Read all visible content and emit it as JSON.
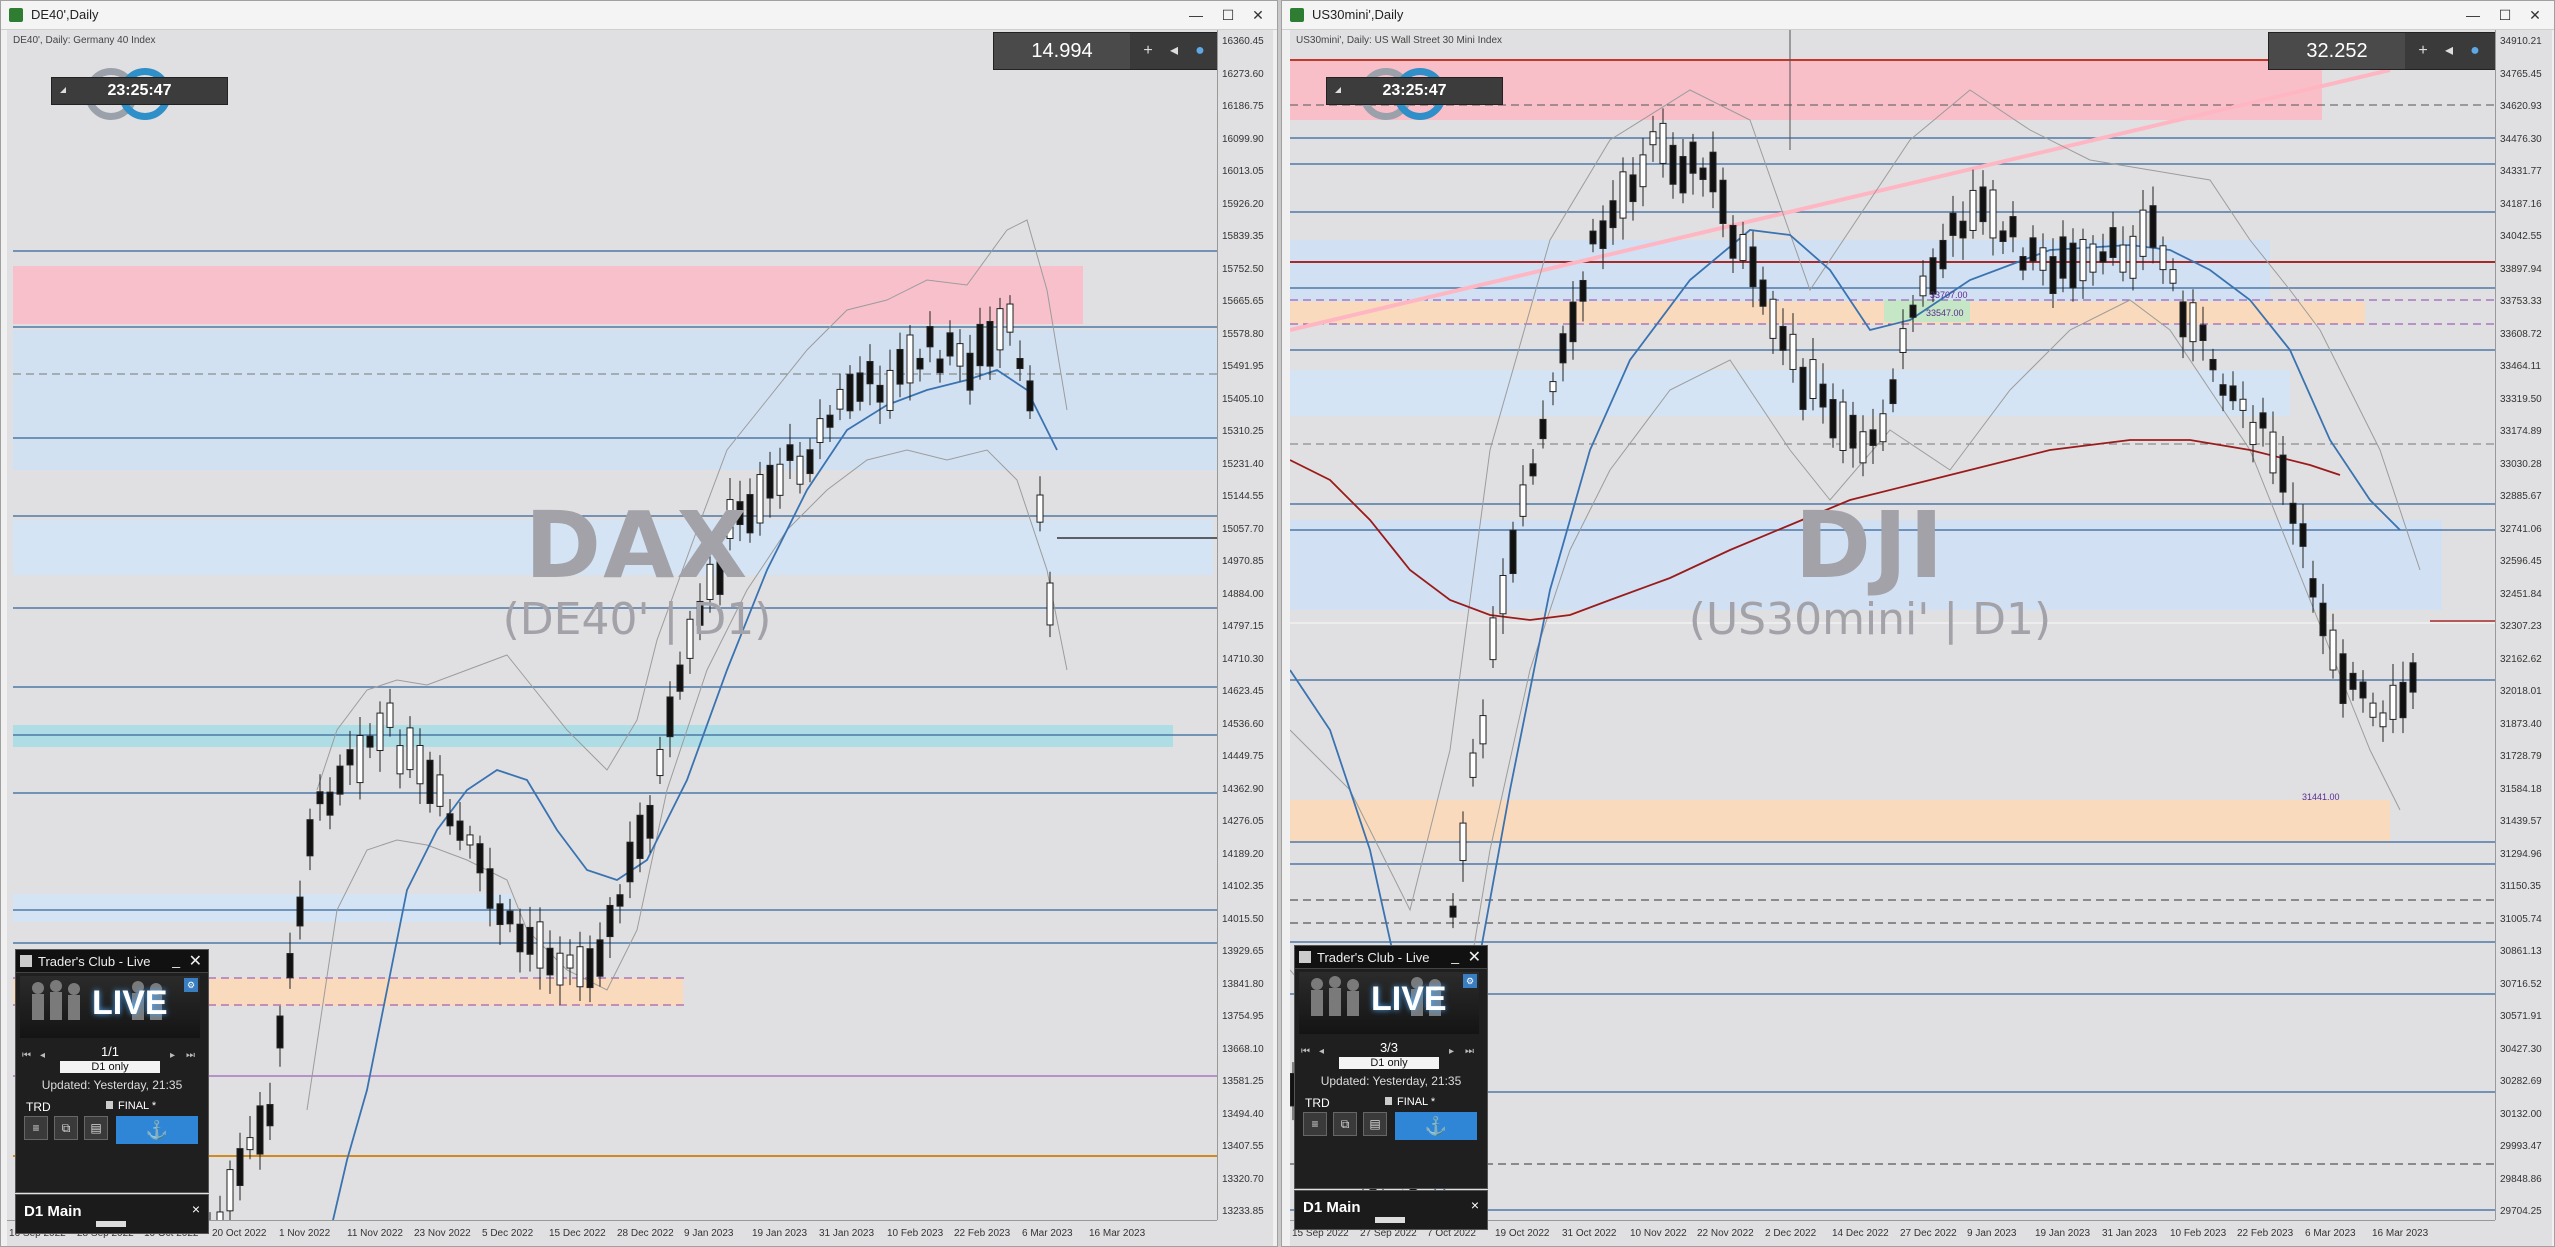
{
  "windows": [
    {
      "title": "DE40',Daily",
      "symbol_info": "DE40', Daily:  Germany 40 Index",
      "watermark_big": "DAX",
      "watermark_small": "(DE40' | D1)",
      "price_box": "14.994",
      "clock": "23:25:47",
      "price_labels": [
        "16360.45",
        "16273.60",
        "16186.75",
        "16099.90",
        "16013.05",
        "15926.20",
        "15839.35",
        "15752.50",
        "15665.65",
        "15578.80",
        "15491.95",
        "15405.10",
        "15310.25",
        "15231.40",
        "15144.55",
        "15057.70",
        "14970.85",
        "14884.00",
        "14797.15",
        "14710.30",
        "14623.45",
        "14536.60",
        "14449.75",
        "14362.90",
        "14276.05",
        "14189.20",
        "14102.35",
        "14015.50",
        "13929.65",
        "13841.80",
        "13754.95",
        "13668.10",
        "13581.25",
        "13494.40",
        "13407.55",
        "13320.70",
        "13233.85"
      ],
      "date_labels": [
        "16 Sep 2022",
        "28 Sep 2022",
        "10 Oct 2022",
        "20 Oct 2022",
        "1 Nov 2022",
        "11 Nov 2022",
        "23 Nov 2022",
        "5 Dec 2022",
        "15 Dec 2022",
        "28 Dec 2022",
        "9 Jan 2023",
        "19 Jan 2023",
        "31 Jan 2023",
        "10 Feb 2023",
        "22 Feb 2023",
        "6 Mar 2023",
        "16 Mar 2023"
      ],
      "panel": {
        "title": "Trader's Club - Live",
        "live": "LIVE",
        "page": "1/1",
        "filter": "D1 only",
        "updated": "Updated: Yesterday, 21:35",
        "trd": "TRD",
        "final": "FINAL *"
      },
      "d1_main": "D1 Main"
    },
    {
      "title": "US30mini',Daily",
      "symbol_info": "US30mini', Daily:  US Wall Street 30 Mini Index",
      "watermark_big": "DJI",
      "watermark_small": "(US30mini' | D1)",
      "price_box": "32.252",
      "clock": "23:25:47",
      "price_labels": [
        "34910.21",
        "34765.45",
        "34620.93",
        "34476.30",
        "34331.77",
        "34187.16",
        "34042.55",
        "33897.94",
        "33753.33",
        "33608.72",
        "33464.11",
        "33319.50",
        "33174.89",
        "33030.28",
        "32885.67",
        "32741.06",
        "32596.45",
        "32451.84",
        "32307.23",
        "32162.62",
        "32018.01",
        "31873.40",
        "31728.79",
        "31584.18",
        "31439.57",
        "31294.96",
        "31150.35",
        "31005.74",
        "30861.13",
        "30716.52",
        "30571.91",
        "30427.30",
        "30282.69",
        "30132.00",
        "29993.47",
        "29848.86",
        "29704.25"
      ],
      "date_labels": [
        "15 Sep 2022",
        "27 Sep 2022",
        "7 Oct 2022",
        "19 Oct 2022",
        "31 Oct 2022",
        "10 Nov 2022",
        "22 Nov 2022",
        "2 Dec 2022",
        "14 Dec 2022",
        "27 Dec 2022",
        "9 Jan 2023",
        "19 Jan 2023",
        "31 Jan 2023",
        "10 Feb 2023",
        "22 Feb 2023",
        "6 Mar 2023",
        "16 Mar 2023"
      ],
      "level_tags": [
        "33707.00",
        "33547.00",
        "31441.00"
      ],
      "panel": {
        "title": "Trader's Club - Live",
        "live": "LIVE",
        "page": "3/3",
        "filter": "D1 only",
        "updated": "Updated: Yesterday, 21:35",
        "trd": "TRD",
        "final": "FINAL *"
      },
      "d1_main": "D1 Main"
    }
  ],
  "window_buttons": {
    "minimize": "—",
    "restore": "☐",
    "close": "✕"
  },
  "price_box_buttons": {
    "plus": "+",
    "arrow": "◂"
  },
  "panel_buttons": {
    "minimize": "_",
    "close": "✕",
    "first": "⏮",
    "prev": "◂",
    "next": "▸",
    "last": "⏭"
  },
  "panel_tool_icons": [
    "≡",
    "⧉",
    "▤",
    "⚓"
  ],
  "d1_close": "×"
}
